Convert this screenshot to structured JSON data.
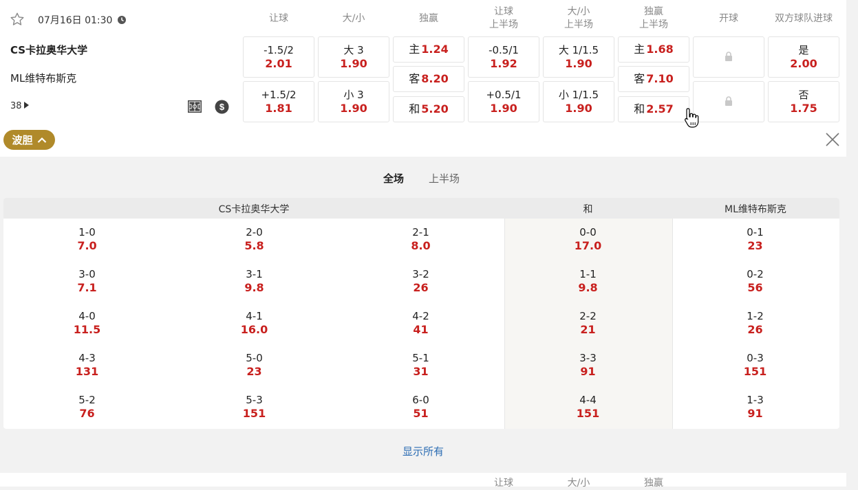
{
  "match": {
    "datetime": "07月16日 01:30",
    "home": "CS卡拉奥华大学",
    "away": "ML维特布斯克",
    "markets_count": "38"
  },
  "columns": [
    {
      "top": "让球",
      "bottom": ""
    },
    {
      "top": "大/小",
      "bottom": ""
    },
    {
      "top": "独赢",
      "bottom": ""
    },
    {
      "top": "让球",
      "bottom": "上半场"
    },
    {
      "top": "大/小",
      "bottom": "上半场"
    },
    {
      "top": "独赢",
      "bottom": "上半场"
    },
    {
      "top": "开球",
      "bottom": ""
    },
    {
      "top": "双方球队进球",
      "bottom": ""
    }
  ],
  "odds": {
    "handicap": [
      {
        "line": "-1.5/2",
        "odds": "2.01"
      },
      {
        "line": "+1.5/2",
        "odds": "1.81"
      }
    ],
    "over_under": [
      {
        "line": "大 3",
        "odds": "1.90"
      },
      {
        "line": "小 3",
        "odds": "1.90"
      }
    ],
    "moneyline": [
      {
        "label": "主",
        "odds": "1.24"
      },
      {
        "label": "客",
        "odds": "8.20"
      },
      {
        "label": "和",
        "odds": "5.20"
      }
    ],
    "handicap_1h": [
      {
        "line": "-0.5/1",
        "odds": "1.92"
      },
      {
        "line": "+0.5/1",
        "odds": "1.90"
      }
    ],
    "over_under_1h": [
      {
        "line": "大 1/1.5",
        "odds": "1.90"
      },
      {
        "line": "小 1/1.5",
        "odds": "1.90"
      }
    ],
    "moneyline_1h": [
      {
        "label": "主",
        "odds": "1.68"
      },
      {
        "label": "客",
        "odds": "7.10"
      },
      {
        "label": "和",
        "odds": "2.57"
      }
    ],
    "both_teams_score": [
      {
        "label": "是",
        "odds": "2.00"
      },
      {
        "label": "否",
        "odds": "1.75"
      }
    ]
  },
  "correct_score": {
    "toggle_label": "波胆",
    "tabs": [
      "全场",
      "上半场"
    ],
    "headers": {
      "home": "CS卡拉奥华大学",
      "draw": "和",
      "away": "ML维特布斯克"
    },
    "home_cols": [
      [
        {
          "score": "1-0",
          "odds": "7.0"
        },
        {
          "score": "3-0",
          "odds": "7.1"
        },
        {
          "score": "4-0",
          "odds": "11.5"
        },
        {
          "score": "4-3",
          "odds": "131"
        },
        {
          "score": "5-2",
          "odds": "76"
        }
      ],
      [
        {
          "score": "2-0",
          "odds": "5.8"
        },
        {
          "score": "3-1",
          "odds": "9.8"
        },
        {
          "score": "4-1",
          "odds": "16.0"
        },
        {
          "score": "5-0",
          "odds": "23"
        },
        {
          "score": "5-3",
          "odds": "151"
        }
      ],
      [
        {
          "score": "2-1",
          "odds": "8.0"
        },
        {
          "score": "3-2",
          "odds": "26"
        },
        {
          "score": "4-2",
          "odds": "41"
        },
        {
          "score": "5-1",
          "odds": "31"
        },
        {
          "score": "6-0",
          "odds": "51"
        }
      ]
    ],
    "draw_col": [
      {
        "score": "0-0",
        "odds": "17.0"
      },
      {
        "score": "1-1",
        "odds": "9.8"
      },
      {
        "score": "2-2",
        "odds": "21"
      },
      {
        "score": "3-3",
        "odds": "91"
      },
      {
        "score": "4-4",
        "odds": "151"
      }
    ],
    "away_col": [
      {
        "score": "0-1",
        "odds": "23"
      },
      {
        "score": "0-2",
        "odds": "56"
      },
      {
        "score": "1-2",
        "odds": "26"
      },
      {
        "score": "0-3",
        "odds": "151"
      },
      {
        "score": "1-3",
        "odds": "91"
      }
    ],
    "show_all": "显示所有"
  },
  "next_row_headers": [
    "让球",
    "大/小",
    "独赢"
  ],
  "colors": {
    "odds_red": "#c8201e",
    "pill_gold": "#b08a2a",
    "link_blue": "#2b6cb3"
  },
  "icons": [
    "star-icon",
    "clock-icon",
    "play-triangle-icon",
    "pitch-icon",
    "dollar-icon",
    "chevron-up-icon",
    "close-icon",
    "lock-icon",
    "hand-cursor-icon"
  ]
}
